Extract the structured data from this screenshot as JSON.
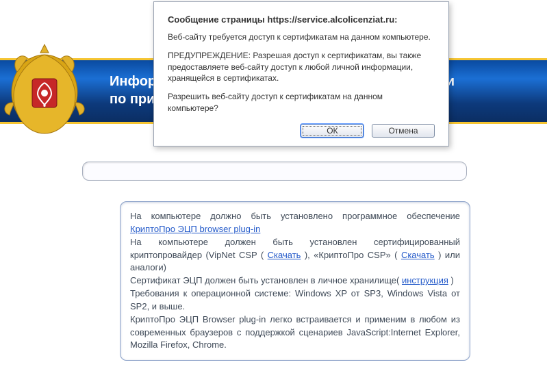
{
  "banner": {
    "title_line1": "Информационная система Российской Федерации",
    "title_line2": "по приёму заявлений"
  },
  "panel": {
    "p1a": "На компьютере должно быть установлено программное обеспечение ",
    "link_plugin": "КриптоПро ЭЦП browser plug-in",
    "p2a": "На компьютере должен быть установлен сертифицированный криптопровайдер (VipNet CSP (",
    "link_dl1": "Скачать",
    "p2b": "), «КриптоПро CSP» (",
    "link_dl2": "Скачать",
    "p2c": ") или аналоги)",
    "p3a": "Сертификат ЭЦП должен быть установлен в личное хранилище(",
    "link_instr": "инструкция",
    "p3b": ")",
    "p4": "Требования к операционной системе: Windows XP от SP3, Windows Vista от SP2, и выше.",
    "p5": "КриптоПро ЭЦП Browser plug-in легко встраивается и применим в любом из современных браузеров с поддержкой сценариев JavaScript:Internet Explorer, Mozilla Firefox, Chrome."
  },
  "dialog": {
    "title": "Сообщение страницы https://service.alcolicenziat.ru:",
    "line1": "Веб-сайту требуется доступ к сертификатам на данном компьютере.",
    "line2": "ПРЕДУПРЕЖДЕНИЕ: Разрешая доступ к сертификатам, вы также предоставляете веб-сайту доступ к любой личной информации, хранящейся в сертификатах.",
    "line3": "Разрешить веб-сайту доступ к сертификатам на данном компьютере?",
    "ok": "ОК",
    "cancel": "Отмена"
  }
}
